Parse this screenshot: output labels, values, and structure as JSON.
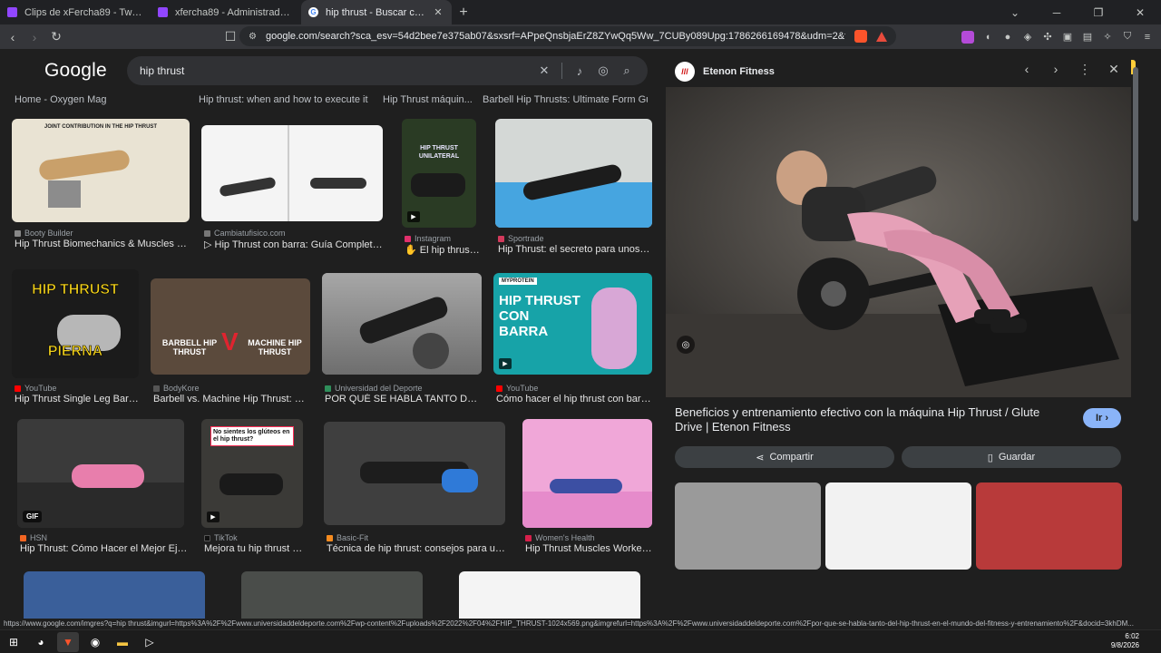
{
  "tabs": [
    {
      "title": "Clips de xFercha89 - Twitch",
      "icon": "twitch-icon",
      "color": "#9146ff"
    },
    {
      "title": "xfercha89 - Administrador de clips -",
      "icon": "twitch-icon",
      "color": "#9146ff"
    },
    {
      "title": "hip thrust - Buscar con Google",
      "icon": "google-icon",
      "color": "#ffffff"
    }
  ],
  "new_tab": "+",
  "window": {
    "dropdown": "⌄",
    "minimize": "─",
    "maximize": "❐",
    "close": "✕"
  },
  "toolbar": {
    "back": "‹",
    "forward": "›",
    "reload": "↻",
    "bookmark": "⬚",
    "site_info": "⚙",
    "url": "google.com/search?sca_esv=54d2bee7e375ab07&sxsrf=APpeQnsbjaErZ8ZYwQq5Ww_7CUBy089Upg:1786266169478&udm=2&fbs=ABfTbFUDadgeu2m..."
  },
  "google": {
    "logo": "Google",
    "query": "hip thrust",
    "clear": "✕",
    "mic": "🎤",
    "lens": "◎",
    "search": "⌕",
    "apps": "⋮⋮⋮"
  },
  "top_captions": [
    "Home - Oxygen Mag",
    "Hip thrust: when and how to execute it - ...",
    "Hip Thrust máquin...",
    "Barbell Hip Thrusts: Ultimate Form Guid..."
  ],
  "results": [
    {
      "source": "Booty Builder",
      "caption": "Hip Thrust Biomechanics & Muscles Work...",
      "src_color": "#888888",
      "label": "JOINT CONTRIBUTION IN THE HIP THRUST"
    },
    {
      "source": "Cambiatufisico.com",
      "caption": "▷ Hip Thrust con barra: Guía Completa par...",
      "src_color": "#777777"
    },
    {
      "source": "Instagram",
      "caption": "✋ El hip thrust uni...",
      "src_color": "#e1306c",
      "label": "HIP THRUST UNILATERAL"
    },
    {
      "source": "Sportrade",
      "caption": "Hip Thrust: el secreto para unos glút...",
      "src_color": "#d33a5c"
    },
    {
      "source": "YouTube",
      "caption": "Hip Thrust Single Leg Barbell...",
      "src_color": "#ff0000",
      "label": "HIP THRUST",
      "label2": "PIERNA"
    },
    {
      "source": "BodyKore",
      "caption": "Barbell vs. Machine Hip Thrust: What'...",
      "src_color": "#555555",
      "label": "BARBELL HIP THRUST",
      "label2": "MACHINE HIP THRUST"
    },
    {
      "source": "Universidad del Deporte",
      "caption": "POR QUÉ SE HABLA TANTO DEL HI...",
      "src_color": "#2f8f5b"
    },
    {
      "source": "YouTube",
      "caption": "Cómo hacer el hip thrust con barra? -...",
      "src_color": "#ff0000",
      "label": "MYPROTEIN",
      "label2": "HIP THRUST CON BARRA"
    },
    {
      "source": "HSN",
      "caption": "Hip Thrust: Cómo Hacer el Mejor Ejercicio...",
      "src_color": "#f26522",
      "label": "GIF"
    },
    {
      "source": "TikTok",
      "caption": "Mejora tu hip thrust par...",
      "src_color": "#111111",
      "label": "No sientes los glúteos en el hip thrust?"
    },
    {
      "source": "Basic-Fit",
      "caption": "Técnica de hip thrust: consejos para unos glút...",
      "src_color": "#f68b1f"
    },
    {
      "source": "Women's Health",
      "caption": "Hip Thrust Muscles Worked: ...",
      "src_color": "#d6204b"
    }
  ],
  "panel": {
    "site": "Etenon Fitness",
    "logo_text": "///",
    "prev": "‹",
    "next": "›",
    "more": "⋮",
    "close": "✕",
    "title": "Beneficios y entrenamiento efectivo con la máquina Hip Thrust / Glute Drive | Etenon Fitness",
    "visit": "Ir ›",
    "share": "Compartir",
    "save": "Guardar"
  },
  "status_url": "https://www.google.com/imgres?q=hip thrust&imgurl=https%3A%2F%2Fwww.universidaddeldeporte.com%2Fwp-content%2Fuploads%2F2022%2F04%2FHIP_THRUST-1024x569.png&imgrefurl=https%3A%2F%2Fwww.universidaddeldeporte.com%2Fpor-que-se-habla-tanto-del-hip-thrust-en-el-mundo-del-fitness-y-entrenamiento%2F&docid=3khDM...",
  "clock": {
    "time": "6:02",
    "date": "9/8/2026"
  }
}
